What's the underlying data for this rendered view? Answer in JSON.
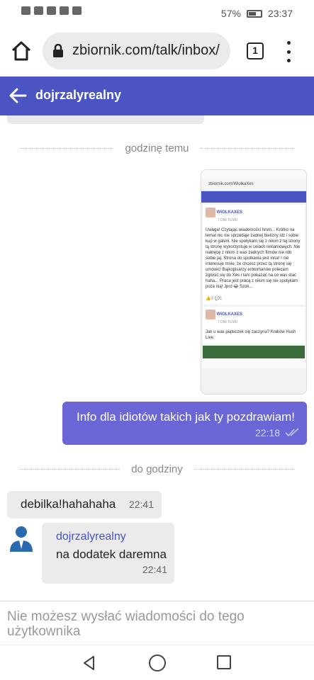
{
  "status_bar": {
    "battery": "57%",
    "time": "23:37"
  },
  "browser": {
    "url": "zbiornik.com/talk/inbox/",
    "tab_count": "1"
  },
  "chat": {
    "title": "dojrzalyrealny",
    "divider1": "godzinę temu",
    "divider2": "do godziny",
    "screenshot": {
      "url": "zbiornik.com/WiolkaXes",
      "post1_author": "WIOLKAXES",
      "post1_meta": "7 DNI TEMU",
      "post1_text": "Uwaga! Czytając wiadomości hmm... Krótko na temat nic nie sprzedaje żadnej bielizny idź i sobie kup w galerii. Nie spotykam się z nikim z tej strony tą stronę wykorzystuje w celach reklamowych. Nie nakręcę z nikim z was żadnych filmów nie rób sobie jaj. Strona do spotkania jest inna! I nie interesuje mnie, że chcesz przez tą stronę się umówić! Bajkopisarzy erotomanów polecam zgłosić się do Xes i tam pokazać na co was stać haha... Praca jest pracą z nikim się nie spotykam poza nią! Jprd 😂 Szok...",
      "post1_stats": "3",
      "post1_comments": "1",
      "post2_author": "WIOLKAXES",
      "post2_meta": "7 DNI TEMU",
      "post2_text": "Jak u was piąteczek się zaczyna? Kraków Hush Live."
    },
    "messages": {
      "sent_text": "Info dla idiotów takich jak ty pozdrawiam!",
      "sent_time": "22:18",
      "recv1_text": "debilka!hahahaha",
      "recv1_time": "22:41",
      "recv2_name": "dojrzalyrealny",
      "recv2_text": "na dodatek daremna",
      "recv2_time": "22:41"
    },
    "footer_note": "Nie możesz wysłać wiadomości do tego użytkownika"
  }
}
